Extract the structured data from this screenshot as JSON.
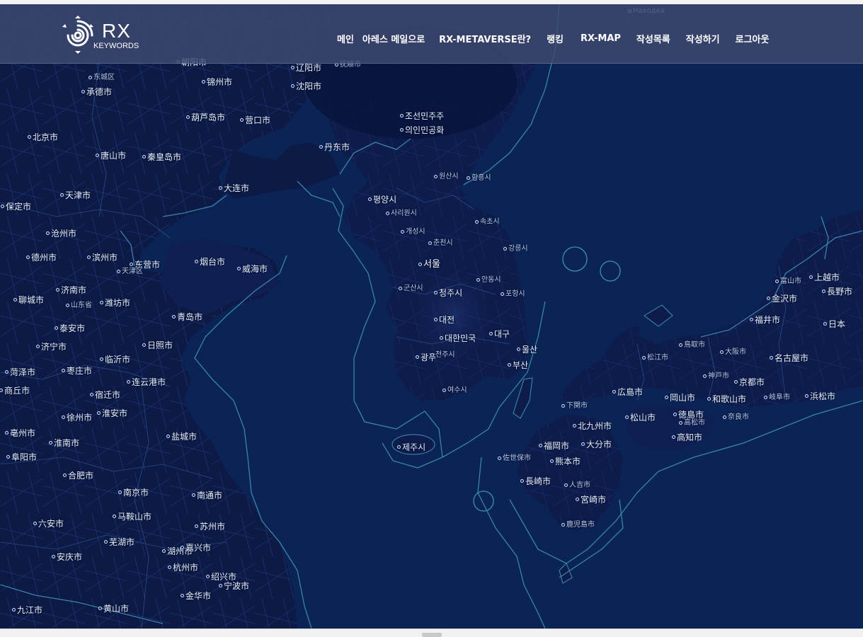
{
  "header": {
    "logo_text": "RX",
    "logo_subtext": "KEYWORDS",
    "nav": [
      "메인",
      "아레스 메일으로",
      "RX-METAVERSE란?",
      "랭킹",
      "RX-MAP",
      "작성목록",
      "작성하기",
      "로그아웃"
    ]
  },
  "map": {
    "colors": {
      "sea": "#0b2456",
      "land": "#0d1a45",
      "land_shade": "#1a2d6b",
      "border": "#3f8fb3"
    },
    "labels": [
      {
        "id": "korea-dprk-1",
        "text": "조선민주주",
        "size": "md"
      },
      {
        "id": "korea-dprk-2",
        "text": "의인민공화",
        "size": "md"
      },
      {
        "id": "pyongyang",
        "text": "평양시",
        "size": "md"
      },
      {
        "id": "seoul",
        "text": "서울",
        "size": "lg"
      },
      {
        "id": "cheongju",
        "text": "청주시",
        "size": "md"
      },
      {
        "id": "daejeon",
        "text": "대전",
        "size": "md"
      },
      {
        "id": "rok",
        "text": "대한민국",
        "size": "md"
      },
      {
        "id": "daegu",
        "text": "대구",
        "size": "md"
      },
      {
        "id": "ulsan",
        "text": "울산",
        "size": "md"
      },
      {
        "id": "busan",
        "text": "부산",
        "size": "md"
      },
      {
        "id": "gwangju",
        "text": "광주",
        "size": "md"
      },
      {
        "id": "yeosu",
        "text": "여수시",
        "size": "sm"
      },
      {
        "id": "jeju",
        "text": "제주시",
        "size": "md"
      },
      {
        "id": "gaeseong",
        "text": "개성시",
        "size": "sm"
      },
      {
        "id": "chuncheon",
        "text": "춘천시",
        "size": "sm"
      },
      {
        "id": "gangneung",
        "text": "강릉시",
        "size": "sm"
      },
      {
        "id": "pohang",
        "text": "포항시",
        "size": "sm"
      },
      {
        "id": "andong",
        "text": "안동시",
        "size": "sm"
      },
      {
        "id": "sokcho",
        "text": "속초시",
        "size": "sm"
      },
      {
        "id": "hamhung",
        "text": "함흥시",
        "size": "sm"
      },
      {
        "id": "wonsan",
        "text": "원산시",
        "size": "sm"
      },
      {
        "id": "sariwon",
        "text": "사리원시",
        "size": "sm"
      },
      {
        "id": "gunsan",
        "text": "군산시",
        "size": "sm"
      },
      {
        "id": "jeonju",
        "text": "전주시",
        "size": "sm"
      },
      {
        "id": "tianjin",
        "text": "天津市",
        "size": "md"
      },
      {
        "id": "beijing",
        "text": "北京市",
        "size": "md"
      },
      {
        "id": "dalian",
        "text": "大连市",
        "size": "md"
      },
      {
        "id": "yingkou",
        "text": "营口市",
        "size": "md"
      },
      {
        "id": "huludao",
        "text": "葫芦岛市",
        "size": "md"
      },
      {
        "id": "qinhuangdao",
        "text": "秦皇岛市",
        "size": "md"
      },
      {
        "id": "tangshan",
        "text": "唐山市",
        "size": "md"
      },
      {
        "id": "dandong",
        "text": "丹东市",
        "size": "md"
      },
      {
        "id": "shenyang",
        "text": "沈阳市",
        "size": "md"
      },
      {
        "id": "liaoyang",
        "text": "辽阳市",
        "size": "md"
      },
      {
        "id": "jinzhou",
        "text": "锦州市",
        "size": "md"
      },
      {
        "id": "chaoyang",
        "text": "朝阳市",
        "size": "md"
      },
      {
        "id": "chengde",
        "text": "承德市",
        "size": "md"
      },
      {
        "id": "fushun",
        "text": "抚顺市",
        "size": "sm"
      },
      {
        "id": "yantai",
        "text": "烟台市",
        "size": "md"
      },
      {
        "id": "weihai",
        "text": "威海市",
        "size": "md"
      },
      {
        "id": "qingdao",
        "text": "青岛市",
        "size": "md"
      },
      {
        "id": "rizhao",
        "text": "日照市",
        "size": "md"
      },
      {
        "id": "lianyungang",
        "text": "连云港市",
        "size": "md"
      },
      {
        "id": "yancheng",
        "text": "盐城市",
        "size": "md"
      },
      {
        "id": "nantong",
        "text": "南通市",
        "size": "md"
      },
      {
        "id": "nanjing",
        "text": "南京市",
        "size": "md"
      },
      {
        "id": "hangzhou",
        "text": "杭州市",
        "size": "md"
      },
      {
        "id": "suzhou",
        "text": "苏州市",
        "size": "md"
      },
      {
        "id": "huzhou",
        "text": "湖州市",
        "size": "md"
      },
      {
        "id": "jiaxing",
        "text": "嘉兴市",
        "size": "md"
      },
      {
        "id": "shaoxing",
        "text": "绍兴市",
        "size": "md"
      },
      {
        "id": "ningbo",
        "text": "宁波市",
        "size": "md"
      },
      {
        "id": "jinhua",
        "text": "金华市",
        "size": "md"
      },
      {
        "id": "huangshan",
        "text": "黄山市",
        "size": "md"
      },
      {
        "id": "jiujiang",
        "text": "九江市",
        "size": "md"
      },
      {
        "id": "anqing",
        "text": "安庆市",
        "size": "md"
      },
      {
        "id": "maanshan",
        "text": "马鞍山市",
        "size": "md"
      },
      {
        "id": "wuhu",
        "text": "芜湖市",
        "size": "md"
      },
      {
        "id": "hefei",
        "text": "合肥市",
        "size": "md"
      },
      {
        "id": "luan",
        "text": "六安市",
        "size": "md"
      },
      {
        "id": "huainan",
        "text": "淮南市",
        "size": "md"
      },
      {
        "id": "huaian",
        "text": "淮安市",
        "size": "md"
      },
      {
        "id": "suqian",
        "text": "宿迁市",
        "size": "md"
      },
      {
        "id": "xuzhou",
        "text": "徐州市",
        "size": "md"
      },
      {
        "id": "linyi",
        "text": "临沂市",
        "size": "md"
      },
      {
        "id": "jining",
        "text": "济宁市",
        "size": "md"
      },
      {
        "id": "taian",
        "text": "泰安市",
        "size": "md"
      },
      {
        "id": "jinan",
        "text": "济南市",
        "size": "md"
      },
      {
        "id": "dezhou",
        "text": "德州市",
        "size": "md"
      },
      {
        "id": "cangzhou",
        "text": "沧州市",
        "size": "md"
      },
      {
        "id": "baoding",
        "text": "保定市",
        "size": "md"
      },
      {
        "id": "binzhou",
        "text": "滨州市",
        "size": "md"
      },
      {
        "id": "dongying",
        "text": "东营市",
        "size": "md"
      },
      {
        "id": "weifang",
        "text": "潍坊市",
        "size": "md"
      },
      {
        "id": "liaocheng",
        "text": "聊城市",
        "size": "md"
      },
      {
        "id": "heze",
        "text": "菏泽市",
        "size": "md"
      },
      {
        "id": "shangqiu",
        "text": "商丘市",
        "size": "md"
      },
      {
        "id": "bozhou",
        "text": "亳州市",
        "size": "md"
      },
      {
        "id": "fuyang",
        "text": "阜阳市",
        "size": "md"
      },
      {
        "id": "zaozhuang",
        "text": "枣庄市",
        "size": "md"
      },
      {
        "id": "fukuoka",
        "text": "福岡市",
        "size": "md"
      },
      {
        "id": "kitakyushu",
        "text": "北九州市",
        "size": "md"
      },
      {
        "id": "oita",
        "text": "大分市",
        "size": "md"
      },
      {
        "id": "kumamoto",
        "text": "熊本市",
        "size": "md"
      },
      {
        "id": "nagasaki",
        "text": "長崎市",
        "size": "md"
      },
      {
        "id": "miyazaki",
        "text": "宮崎市",
        "size": "md"
      },
      {
        "id": "kagoshima",
        "text": "鹿児島市",
        "size": "sm"
      },
      {
        "id": "hiroshima",
        "text": "広島市",
        "size": "md"
      },
      {
        "id": "matsuyama",
        "text": "松山市",
        "size": "md"
      },
      {
        "id": "kochi",
        "text": "高知市",
        "size": "md"
      },
      {
        "id": "okayama",
        "text": "岡山市",
        "size": "md"
      },
      {
        "id": "tokushima",
        "text": "徳島市",
        "size": "md"
      },
      {
        "id": "wakayama",
        "text": "和歌山市",
        "size": "md"
      },
      {
        "id": "kyoto",
        "text": "京都市",
        "size": "md"
      },
      {
        "id": "nagoya",
        "text": "名古屋市",
        "size": "md"
      },
      {
        "id": "hamamatsu",
        "text": "浜松市",
        "size": "md"
      },
      {
        "id": "fukui",
        "text": "福井市",
        "size": "md"
      },
      {
        "id": "kanazawa",
        "text": "金沢市",
        "size": "md"
      },
      {
        "id": "nagano",
        "text": "長野市",
        "size": "md"
      },
      {
        "id": "niigata",
        "text": "上越市",
        "size": "md"
      },
      {
        "id": "nihon",
        "text": "日本",
        "size": "md"
      },
      {
        "id": "tottori",
        "text": "鳥取市",
        "size": "sm"
      },
      {
        "id": "matsue",
        "text": "松江市",
        "size": "sm"
      },
      {
        "id": "shimonoseki",
        "text": "下関市",
        "size": "sm"
      },
      {
        "id": "takamatsu",
        "text": "高松市",
        "size": "sm"
      },
      {
        "id": "kobe",
        "text": "神戸市",
        "size": "sm"
      },
      {
        "id": "osaka",
        "text": "大阪市",
        "size": "sm"
      },
      {
        "id": "nara",
        "text": "奈良市",
        "size": "sm"
      },
      {
        "id": "gifu",
        "text": "岐阜市",
        "size": "sm"
      },
      {
        "id": "toyama",
        "text": "富山市",
        "size": "sm"
      },
      {
        "id": "hitoyoshi",
        "text": "人吉市",
        "size": "sm"
      },
      {
        "id": "sasebo",
        "text": "佐世保市",
        "size": "sm"
      },
      {
        "id": "nakhodka",
        "text": "Находка",
        "size": "sm"
      },
      {
        "id": "dongcheng",
        "text": "东城区",
        "size": "sm"
      },
      {
        "id": "zhuhai",
        "text": "天津区",
        "size": "sm"
      },
      {
        "id": "shandong",
        "text": "山东省",
        "size": "sm"
      }
    ]
  }
}
